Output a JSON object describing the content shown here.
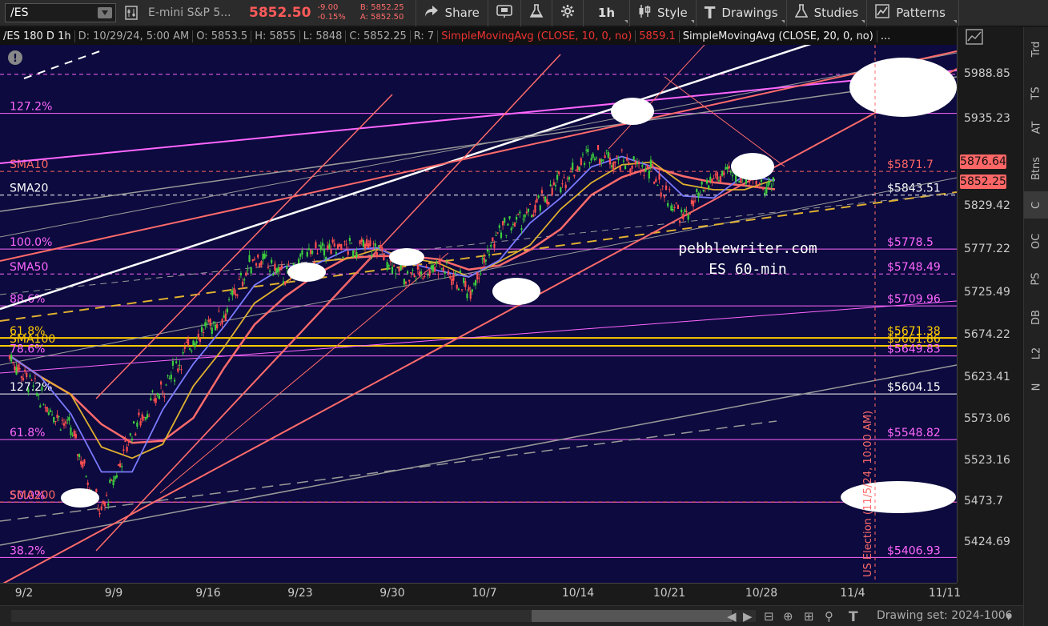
{
  "toolbar": {
    "symbol": "/ES",
    "description": "E-mini S&P 5...",
    "last_price": "5852.50",
    "change": "-9.00",
    "change_pct": "-0.15%",
    "bid": "B: 5852.25",
    "ask": "A: 5852.50",
    "share_label": "Share",
    "timeframe_label": "1h",
    "style_label": "Style",
    "drawings_label": "Drawings",
    "studies_label": "Studies",
    "patterns_label": "Patterns"
  },
  "infobar": {
    "period": "/ES 180 D 1h",
    "date": "D: 10/29/24, 5:00 AM",
    "open": "O: 5853.5",
    "high": "H: 5855",
    "low": "L: 5848",
    "close": "C: 5852.25",
    "range": "R: 7",
    "sma10_label": "SimpleMovingAvg (CLOSE, 10, 0, no)",
    "sma10_value": "5859.1",
    "sma20_label": "SimpleMovingAvg (CLOSE, 20, 0, no)",
    "more": "..."
  },
  "price_axis": {
    "ticks": [
      "5988.85",
      "5935.23",
      "5829.42",
      "5777.22",
      "5725.49",
      "5674.22",
      "5623.41",
      "5573.06",
      "5523.16",
      "5473.7",
      "5424.69"
    ],
    "tag_sma10": "5876.64",
    "tag_last": "5852.25"
  },
  "side_tabs": [
    "Trd",
    "TS",
    "AT",
    "Btns",
    "C",
    "OC",
    "PS",
    "DB",
    "L2",
    "N"
  ],
  "date_axis": [
    "9/2",
    "9/9",
    "9/16",
    "9/23",
    "9/30",
    "10/7",
    "10/14",
    "10/21",
    "10/28",
    "11/4",
    "11/11"
  ],
  "bottombar": {
    "drawing_set": "Drawing set: 2024-1006"
  },
  "chart_data": {
    "type": "line",
    "title": "",
    "xlabel": "",
    "ylabel": "",
    "ylim": [
      5395,
      6030
    ],
    "watermark": [
      "pebblewriter.com",
      "ES 60-min"
    ],
    "annotation": "US Election (11/5/24, 10:00 AM)",
    "x": [
      "9/2",
      "9/4",
      "9/6",
      "9/9",
      "9/11",
      "9/13",
      "9/16",
      "9/18",
      "9/20",
      "9/23",
      "9/25",
      "9/27",
      "9/30",
      "10/2",
      "10/4",
      "10/7",
      "10/9",
      "10/11",
      "10/14",
      "10/16",
      "10/18",
      "10/21",
      "10/23",
      "10/25",
      "10/28",
      "10/29"
    ],
    "series": [
      {
        "name": "",
        "values": [
          5650,
          5600,
          5560,
          5460,
          5560,
          5610,
          5670,
          5700,
          5770,
          5745,
          5775,
          5780,
          5780,
          5745,
          5760,
          5730,
          5800,
          5820,
          5860,
          5895,
          5885,
          5870,
          5815,
          5865,
          5870,
          5852
        ]
      }
    ],
    "levels": [
      {
        "label": "",
        "value": "5988.85",
        "price": 5989,
        "color": "#ff66ff"
      },
      {
        "label": "127.2%",
        "value": "$5942.04",
        "price": 5942,
        "color": "#ff66ff"
      },
      {
        "label": "SMA10",
        "value": "$5871.7",
        "price": 5872,
        "color": "#ff6666"
      },
      {
        "label": "SMA20",
        "value": "$5843.51",
        "price": 5843.5,
        "color": "#ffffff"
      },
      {
        "label": "100.0%",
        "value": "$5778.5",
        "price": 5778.5,
        "color": "#ff66ff"
      },
      {
        "label": "SMA50",
        "value": "$5748.49",
        "price": 5748.5,
        "color": "#ff66ff"
      },
      {
        "label": "88.6%",
        "value": "$5709.96",
        "price": 5710,
        "color": "#ff66ff"
      },
      {
        "label": "61.8%",
        "value": "$5671.38",
        "price": 5671.4,
        "color": "#ffcc00"
      },
      {
        "label": "SMA100",
        "value": "$5661.86",
        "price": 5661.9,
        "color": "#ffcc00"
      },
      {
        "label": "78.6%",
        "value": "$5649.83",
        "price": 5649.8,
        "color": "#ff66ff"
      },
      {
        "label": "127.2%",
        "value": "$5604.15",
        "price": 5604,
        "color": "#ffffff"
      },
      {
        "label": "61.8%",
        "value": "$5548.82",
        "price": 5549,
        "color": "#ff66ff"
      },
      {
        "label": "50.0%",
        "value": "$5473.58",
        "price": 5473.6,
        "color": "#ff66ff"
      },
      {
        "label": "SMA200",
        "value": "$5473.73",
        "price": 5473.7,
        "color": "#ff6666"
      },
      {
        "label": "38.2%",
        "value": "$5406.93",
        "price": 5407,
        "color": "#ff66ff"
      }
    ],
    "grid": false
  }
}
